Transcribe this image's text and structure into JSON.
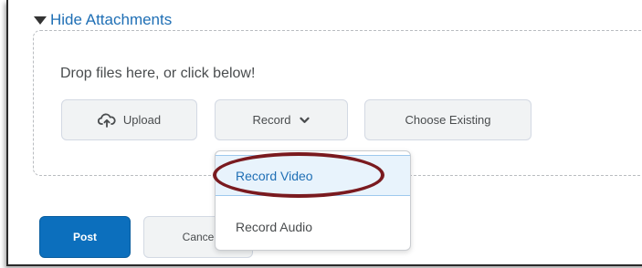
{
  "attachments": {
    "toggle_label": "Hide Attachments",
    "toggle_icon": "caret-down-icon",
    "drop_prompt": "Drop files here, or click below!",
    "upload_label": "Upload",
    "upload_icon": "cloud-upload-icon",
    "record_label": "Record",
    "record_icon": "chevron-down-icon",
    "choose_existing_label": "Choose Existing"
  },
  "record_menu": {
    "items": [
      {
        "label": "Record Video",
        "highlighted": true
      },
      {
        "label": "Record Audio",
        "highlighted": false
      }
    ]
  },
  "actions": {
    "post_label": "Post",
    "cancel_label": "Cance"
  },
  "colors": {
    "link_blue": "#1f6fb5",
    "primary_button": "#0c6fbd",
    "menu_highlight_bg": "#e8f3fc",
    "annotation_ring": "#7a1a1f"
  }
}
